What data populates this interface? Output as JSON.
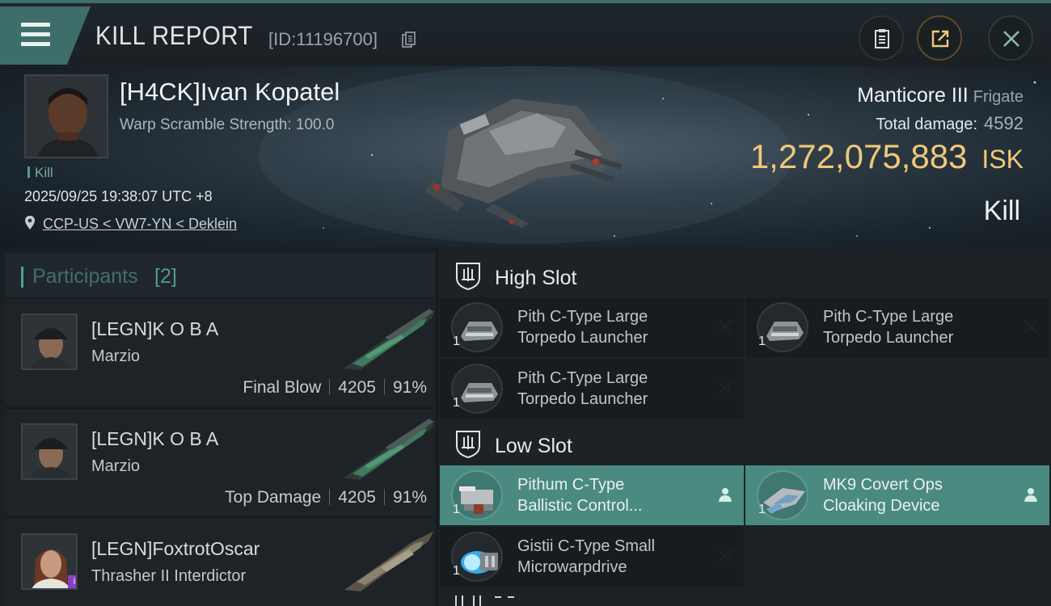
{
  "header": {
    "title": "KILL REPORT",
    "report_id": "[ID:11196700]"
  },
  "victim": {
    "name": "[H4CK]Ivan Kopatel",
    "warp_scramble": "Warp Scramble Strength: 100.0",
    "kill_tag": "Kill",
    "datetime": "2025/09/25 19:38:07 UTC +8",
    "location": "CCP-US < VW7-YN < Deklein",
    "ship": "Manticore III",
    "ship_class": "Frigate",
    "total_damage_label": "Total damage:",
    "total_damage": "4592",
    "isk_value": "1,272,075,883",
    "isk_unit": "ISK",
    "result": "Kill"
  },
  "participants": {
    "title": "Participants",
    "count": "[2]",
    "list": [
      {
        "name": "[LEGN]K O B A",
        "ship": "Marzio",
        "role": "Final Blow",
        "damage": "4205",
        "percent": "91%"
      },
      {
        "name": "[LEGN]K O B A",
        "ship": "Marzio",
        "role": "Top Damage",
        "damage": "4205",
        "percent": "91%"
      },
      {
        "name": "[LEGN]FoxtrotOscar",
        "ship": "Thrasher II Interdictor"
      }
    ]
  },
  "fitting": {
    "high_slot_label": "High Slot",
    "low_slot_label": "Low Slot",
    "high": [
      {
        "line1": "Pith C-Type Large",
        "line2": "Torpedo Launcher",
        "qty": "1",
        "state": "destroyed"
      },
      {
        "line1": "Pith C-Type Large",
        "line2": "Torpedo Launcher",
        "qty": "1",
        "state": "destroyed"
      },
      {
        "line1": "Pith C-Type Large",
        "line2": "Torpedo Launcher",
        "qty": "1",
        "state": "destroyed"
      }
    ],
    "low": [
      {
        "line1": "Pithum C-Type",
        "line2": "Ballistic Control...",
        "qty": "1",
        "state": "dropped"
      },
      {
        "line1": "MK9 Covert Ops",
        "line2": "Cloaking Device",
        "qty": "1",
        "state": "dropped"
      },
      {
        "line1": "Gistii C-Type Small",
        "line2": "Microwarpdrive",
        "qty": "1",
        "state": "destroyed"
      }
    ]
  },
  "colors": {
    "accent": "#4b8a80",
    "isk": "#efc879",
    "background": "#15191d"
  }
}
